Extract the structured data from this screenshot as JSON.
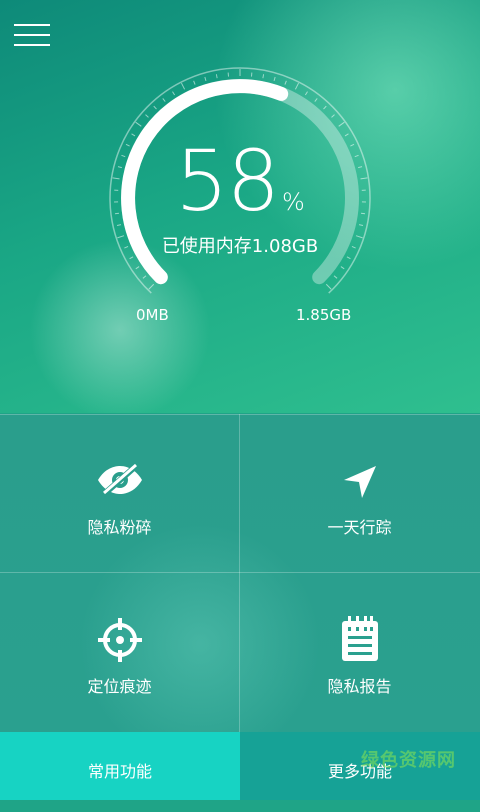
{
  "header": {
    "menu_icon": "hamburger-menu-icon"
  },
  "memory": {
    "percent": "58",
    "percent_symbol": "%",
    "used_text": "已使用内存1.08GB",
    "min_label": "0MB",
    "max_label": "1.85GB",
    "fill_fraction": 0.58
  },
  "features": [
    {
      "label": "隐私粉碎",
      "icon": "eye-slash-icon"
    },
    {
      "label": "一天行踪",
      "icon": "navigation-arrow-icon"
    },
    {
      "label": "定位痕迹",
      "icon": "crosshair-icon"
    },
    {
      "label": "隐私报告",
      "icon": "notepad-icon"
    }
  ],
  "tabs": [
    {
      "label": "常用功能"
    },
    {
      "label": "更多功能"
    }
  ],
  "watermark": "绿色资源网",
  "colors": {
    "accent": "#17d3c3",
    "background": "#1fa487",
    "tab_inactive": "#16a296"
  }
}
